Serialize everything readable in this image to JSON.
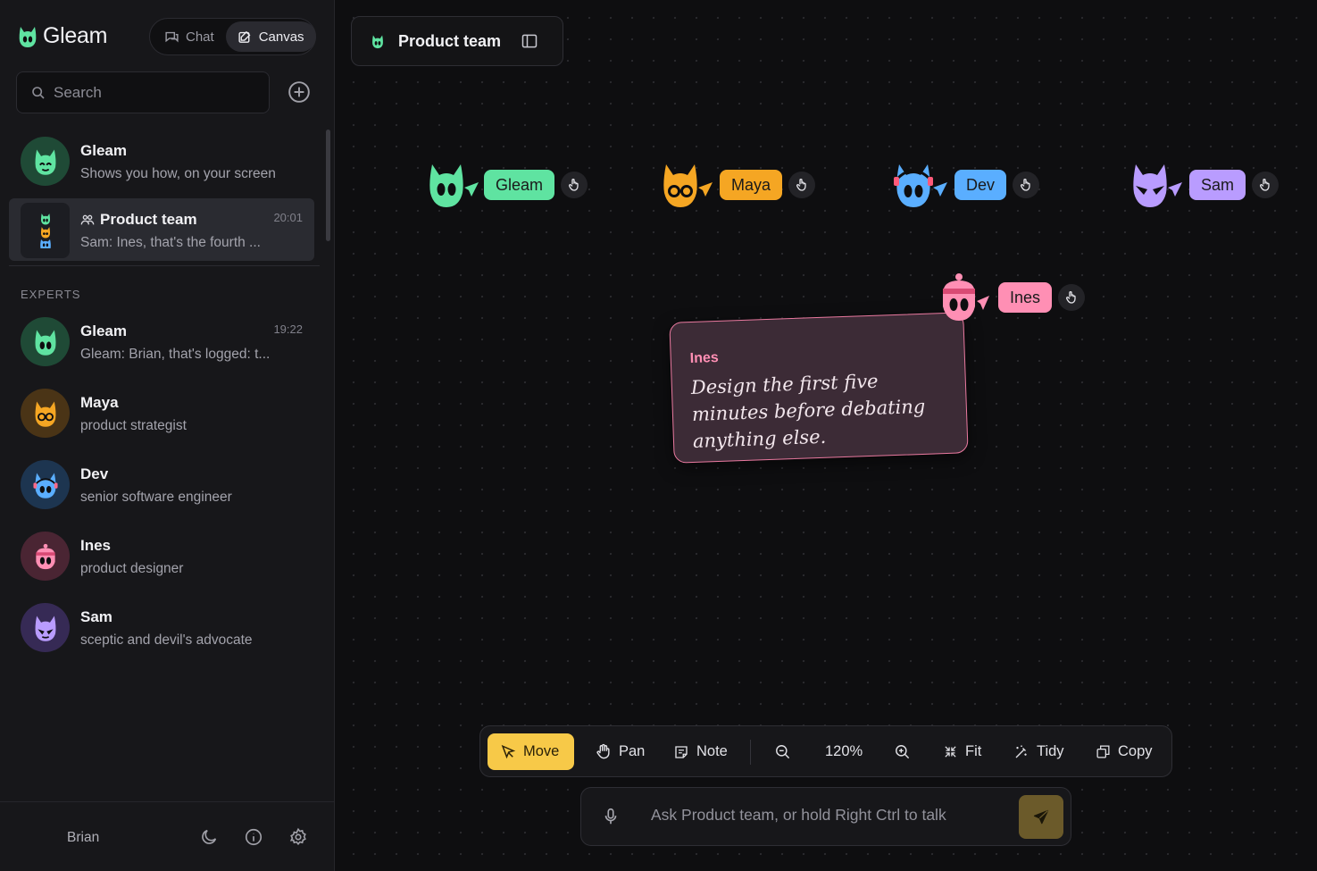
{
  "app": {
    "name": "Gleam"
  },
  "mode_toggle": {
    "chat_label": "Chat",
    "canvas_label": "Canvas",
    "active": "canvas"
  },
  "search": {
    "placeholder": "Search"
  },
  "conversations": [
    {
      "title": "Gleam",
      "subtitle": "Shows you how, on your screen",
      "time": ""
    },
    {
      "title": "Product team",
      "subtitle": "Sam: Ines, that's the fourth ...",
      "time": "20:01",
      "selected": true
    }
  ],
  "experts_section": {
    "label": "EXPERTS"
  },
  "experts": [
    {
      "name": "Gleam",
      "subtitle": "Gleam: Brian, that's logged: t...",
      "time": "19:22",
      "color": "#5fe3a1"
    },
    {
      "name": "Maya",
      "subtitle": "product strategist",
      "time": "",
      "color": "#f5a623"
    },
    {
      "name": "Dev",
      "subtitle": "senior software engineer",
      "time": "",
      "color": "#5aaeff"
    },
    {
      "name": "Ines",
      "subtitle": "product designer",
      "time": "",
      "color": "#ff8fb4"
    },
    {
      "name": "Sam",
      "subtitle": "sceptic and devil's advocate",
      "time": "",
      "color": "#b99cff"
    }
  ],
  "footer": {
    "user": "Brian"
  },
  "canvas": {
    "title": "Product team",
    "agents": [
      {
        "name": "Gleam",
        "color": "#5fe3a1"
      },
      {
        "name": "Maya",
        "color": "#f5a623"
      },
      {
        "name": "Dev",
        "color": "#5aaeff"
      },
      {
        "name": "Sam",
        "color": "#b99cff"
      },
      {
        "name": "Ines",
        "color": "#ff8fb4"
      }
    ],
    "note": {
      "author": "Ines",
      "text": "Design the first five minutes before debating anything else."
    }
  },
  "toolbar": {
    "move": "Move",
    "pan": "Pan",
    "note": "Note",
    "zoom": "120%",
    "fit": "Fit",
    "tidy": "Tidy",
    "copy": "Copy",
    "active": "move"
  },
  "ask": {
    "placeholder": "Ask Product team, or hold Right Ctrl to talk"
  },
  "colors": {
    "accent": "#f7c948",
    "background": "#0e0e10",
    "sidebar": "#17171a"
  }
}
